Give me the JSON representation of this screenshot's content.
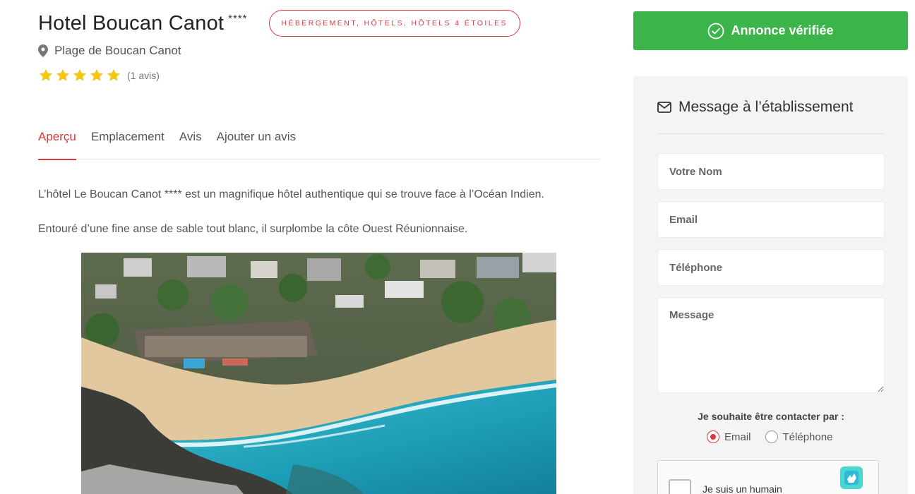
{
  "listing": {
    "title": "Hotel Boucan Canot",
    "rating_stars_text": "****",
    "category": "HÉBERGEMENT, HÔTELS, HÔTELS 4 ÉTOILES",
    "location": "Plage de Boucan Canot",
    "rating": 5,
    "rating_max": 5,
    "review_count": "(1 avis)"
  },
  "tabs": [
    {
      "label": "Aperçu",
      "active": true
    },
    {
      "label": "Emplacement",
      "active": false
    },
    {
      "label": "Avis",
      "active": false
    },
    {
      "label": "Ajouter un avis",
      "active": false
    }
  ],
  "description": {
    "p1": "L’hôtel Le Boucan Canot **** est un magnifique hôtel authentique qui se trouve face à l’Océan Indien.",
    "p2": "Entouré d’une fine anse de sable tout blanc, il surplombe la côte Ouest Réunionnaise."
  },
  "sidebar": {
    "verified_label": "Annonce vérifiée",
    "message_title": "Message à l’établissement",
    "name_placeholder": "Votre Nom",
    "email_placeholder": "Email",
    "phone_placeholder": "Téléphone",
    "message_placeholder": "Message",
    "contact_pref_label": "Je souhaite être contacter par :",
    "contact_options": [
      {
        "label": "Email",
        "checked": true
      },
      {
        "label": "Téléphone",
        "checked": false
      }
    ],
    "captcha_label": "Je suis un humain"
  },
  "colors": {
    "accent": "#d93a3a",
    "verified": "#3bb44a",
    "star": "#f5c518"
  },
  "icons": [
    "map-pin-icon",
    "star-icon",
    "check-circle-icon",
    "envelope-icon",
    "hcaptcha-logo-icon"
  ]
}
